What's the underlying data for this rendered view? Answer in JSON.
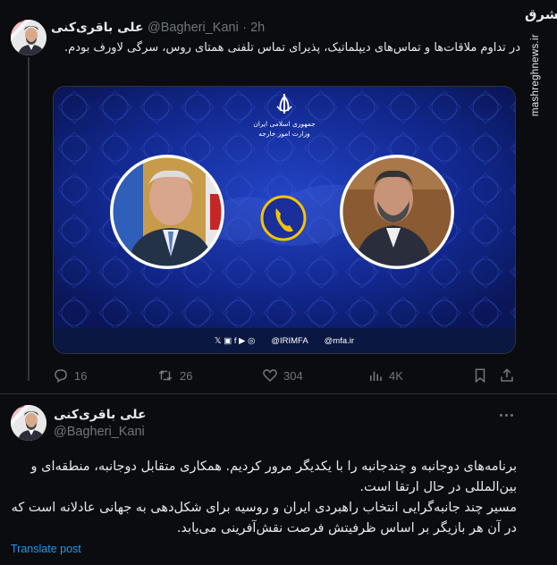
{
  "watermark": {
    "logo": "مشرق",
    "url": "mashreghnews.ir"
  },
  "tweet1": {
    "name": "علی باقری‌کنی",
    "handle": "@Bagheri_Kani",
    "time": "· 2h",
    "text": "در تداوم ملاقات‌ها و تماس‌های دیپلماتیک، پذیرای تماس تلفنی همتای روس، سرگی لاورف بودم.",
    "media": {
      "emblem_lines": [
        "جمهوری اسلامی ایران",
        "وزارت امور خارجه"
      ],
      "footer_handle": "@IRIMFA",
      "footer_site": "@mfa.ir"
    },
    "actions": {
      "replies": "16",
      "retweets": "26",
      "likes": "304",
      "views": "4K"
    }
  },
  "tweet2": {
    "name": "علی باقری‌کنی",
    "handle": "@Bagheri_Kani",
    "text": "برنامه‌های دوجانبه و چندجانبه را با یکدیگر مرور کردیم. همکاری متقابل دوجانبه، منطقه‌ای و بین‌المللی در حال ارتقا است.\nمسیر چند جانبه‌گرایی انتخاب راهبردی ایران و روسیه برای شکل‌دهی به جهانی عادلانه است که در آن هر بازیگر بر اساس ظرفیتش فرصت نقش‌آفرینی می‌یابد.",
    "translate": "Translate post"
  },
  "colors": {
    "background": "#0a0c10",
    "accent": "#1d9bf0",
    "muted": "#71767b",
    "media_blue": "#0b1f7a"
  }
}
